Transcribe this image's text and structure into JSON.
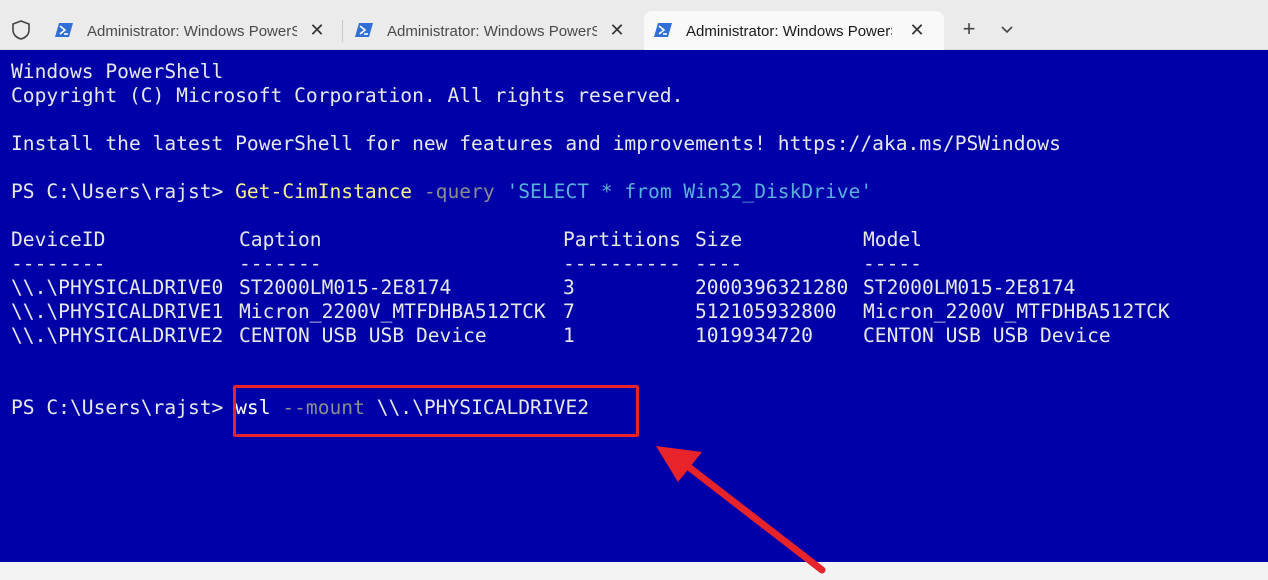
{
  "tabs": [
    {
      "title": "Administrator: Windows PowerShell",
      "close": "✕"
    },
    {
      "title": "Administrator: Windows PowerShell",
      "close": "✕"
    },
    {
      "title": "Administrator: Windows PowerShell",
      "close": "✕"
    }
  ],
  "tabbar": {
    "new_tab": "+"
  },
  "terminal": {
    "line1": "Windows PowerShell",
    "line2": "Copyright (C) Microsoft Corporation. All rights reserved.",
    "line3": "Install the latest PowerShell for new features and improvements! https://aka.ms/PSWindows",
    "cmd1": {
      "prompt": "PS C:\\Users\\rajst> ",
      "name": "Get-CimInstance",
      "param": " -query",
      "arg": " 'SELECT * from Win32_DiskDrive'"
    },
    "table": {
      "headers": [
        "DeviceID",
        "Caption",
        "Partitions",
        "Size",
        "Model"
      ],
      "underlines": [
        "--------",
        "-------",
        "----------",
        "----",
        "-----"
      ],
      "rows": [
        [
          "\\\\.\\PHYSICALDRIVE0",
          "ST2000LM015-2E8174",
          "3",
          "2000396321280",
          "ST2000LM015-2E8174"
        ],
        [
          "\\\\.\\PHYSICALDRIVE1",
          "Micron_2200V_MTFDHBA512TCK",
          "7",
          "512105932800",
          "Micron_2200V_MTFDHBA512TCK"
        ],
        [
          "\\\\.\\PHYSICALDRIVE2",
          "CENTON USB USB Device",
          "1",
          "1019934720",
          "CENTON USB USB Device"
        ]
      ]
    },
    "cmd2": {
      "prompt": "PS C:\\Users\\rajst> ",
      "name": "wsl",
      "param": " --mount",
      "arg": " \\\\.\\PHYSICALDRIVE2"
    }
  },
  "colors": {
    "terminal_bg": "#0000a8",
    "command_name": "#f7f18a",
    "parameter": "#8d8d8d",
    "string_arg": "#57b2dc",
    "annotation_red": "#e8232a"
  },
  "icons": [
    "shield-icon",
    "powershell-icon",
    "close-icon",
    "plus-icon",
    "chevron-down-icon",
    "arrow-annotation"
  ]
}
